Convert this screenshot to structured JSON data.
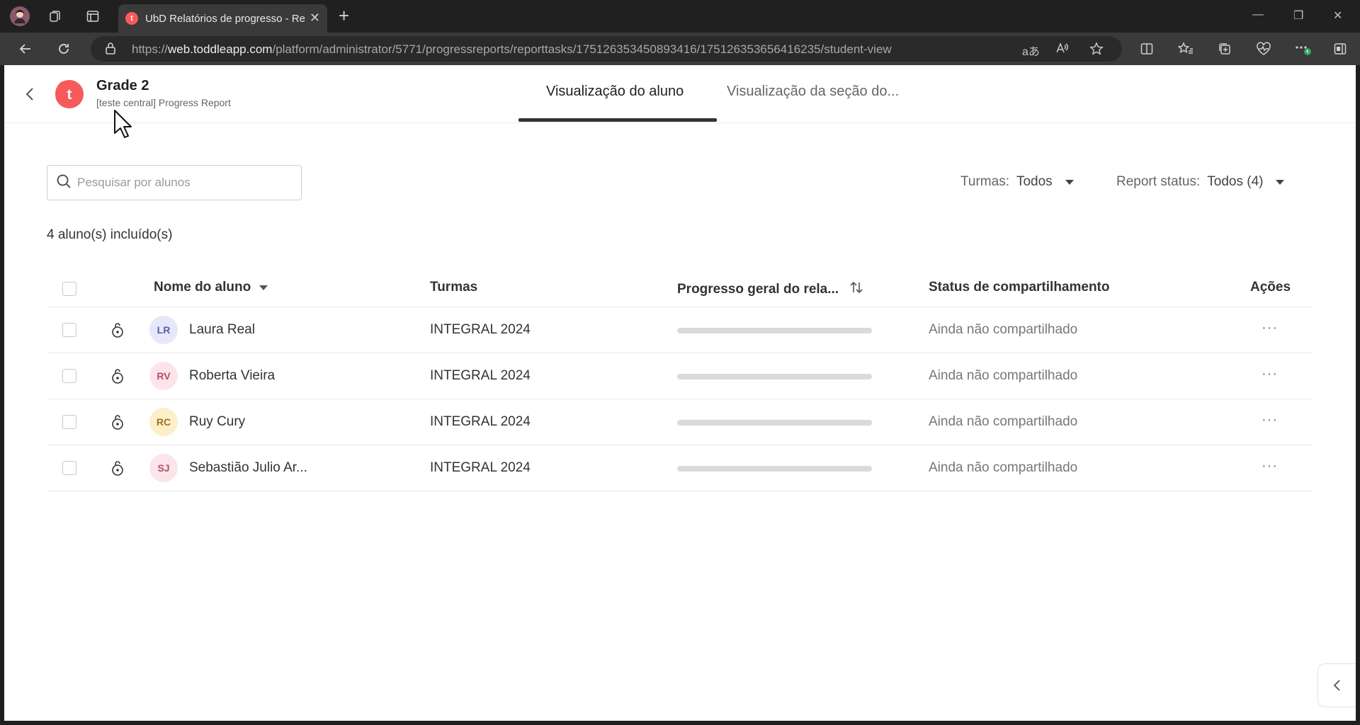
{
  "browser": {
    "tab_title": "UbD Relatórios de progresso - Re",
    "tab_favicon_letter": "t",
    "url_prefix": "https://",
    "url_host": "web.toddleapp.com",
    "url_path": "/platform/administrator/5771/progressreports/reporttasks/175126353450893416/175126353656416235/student-view",
    "read_aloud_label": "Aͅ",
    "translate_label": "aあ"
  },
  "header": {
    "logo_letter": "t",
    "title": "Grade 2",
    "subtitle": "[teste central] Progress Report",
    "tabs": [
      {
        "label": "Visualização do aluno"
      },
      {
        "label": "Visualização da seção do..."
      }
    ]
  },
  "toolbar": {
    "search_placeholder": "Pesquisar por alunos",
    "filter_classes_label": "Turmas:",
    "filter_classes_value": "Todos",
    "filter_status_label": "Report status:",
    "filter_status_value": "Todos (4)"
  },
  "summary": {
    "count_text": "4 aluno(s) incluído(s)"
  },
  "table": {
    "headers": {
      "name": "Nome do aluno",
      "classes": "Turmas",
      "progress": "Progresso geral do rela...",
      "sharing": "Status de compartilhamento",
      "actions": "Ações"
    },
    "rows": [
      {
        "initials": "LR",
        "name": "Laura Real",
        "classes": "INTEGRAL 2024",
        "progress": 0,
        "sharing": "Ainda não compartilhado",
        "avatar_bg": "#e6e7f8",
        "avatar_fg": "#5a5fb0"
      },
      {
        "initials": "RV",
        "name": "Roberta Vieira",
        "classes": "INTEGRAL 2024",
        "progress": 0,
        "sharing": "Ainda não compartilhado",
        "avatar_bg": "#fbe5ea",
        "avatar_fg": "#b0506a"
      },
      {
        "initials": "RC",
        "name": "Ruy Cury",
        "classes": "INTEGRAL 2024",
        "progress": 0,
        "sharing": "Ainda não compartilhado",
        "avatar_bg": "#fcefc9",
        "avatar_fg": "#9a7320"
      },
      {
        "initials": "SJ",
        "name": "Sebastião Julio Ar...",
        "classes": "INTEGRAL 2024",
        "progress": 0,
        "sharing": "Ainda não compartilhado",
        "avatar_bg": "#fbe5ea",
        "avatar_fg": "#b0506a"
      }
    ],
    "actions_glyph": "···"
  },
  "colors": {
    "brand": "#f75a5a",
    "tab_underline": "#333333"
  }
}
